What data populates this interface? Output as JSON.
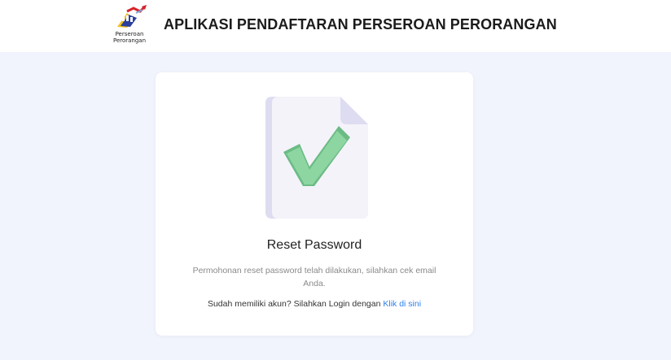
{
  "header": {
    "logo_caption_line1": "Perseroan",
    "logo_caption_line2": "Perorangan",
    "title": "APLIKASI PENDAFTARAN PERSEROAN PERORANGAN"
  },
  "card": {
    "illustration_icon": "document-checkmark-icon",
    "title": "Reset Password",
    "message": "Permohonan reset password telah dilakukan, silahkan cek email Anda.",
    "login_prompt": "Sudah memiliki akun? Silahkan Login dengan",
    "login_link_label": "Klik di sini"
  },
  "colors": {
    "page_background": "#f1f4fc",
    "link": "#2f80ed",
    "check_green": "#86d39b"
  }
}
